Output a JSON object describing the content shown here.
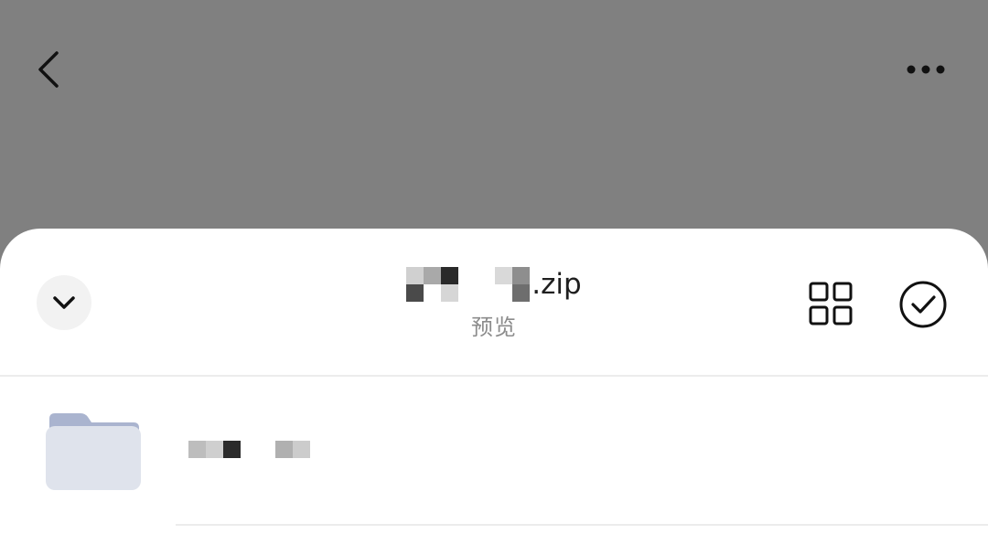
{
  "top_bar": {
    "back_icon": "chevron-left-icon",
    "more_icon": "more-horizontal-icon"
  },
  "sheet": {
    "collapse_icon": "chevron-down-icon",
    "file_title": ".zip",
    "subtitle": "预览",
    "grid_view_icon": "grid-icon",
    "confirm_icon": "check-circle-icon"
  },
  "list": {
    "items": [
      {
        "type": "folder",
        "icon": "folder-icon",
        "name_redacted": true
      }
    ]
  },
  "colors": {
    "backdrop": "#808080",
    "sheet_background": "#ffffff",
    "folder_tab": "#aab4cf",
    "folder_body": "#dfe3ec",
    "subtitle_text": "#8c8c8c"
  }
}
